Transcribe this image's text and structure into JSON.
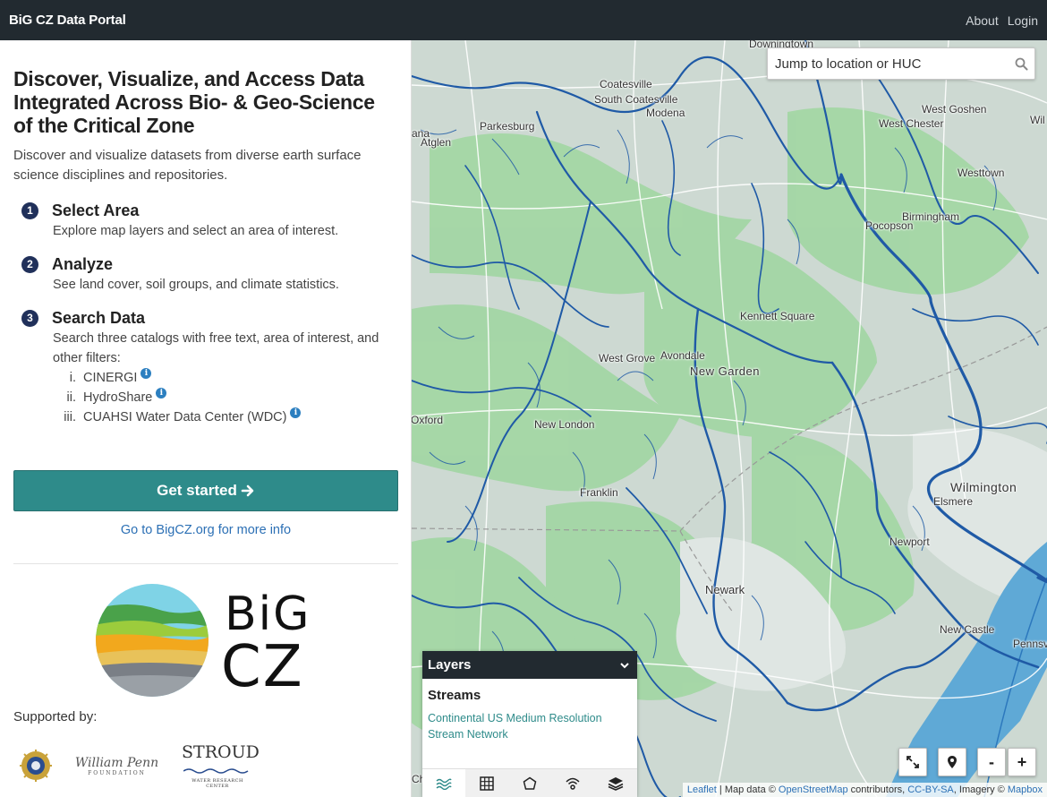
{
  "navbar": {
    "brand": "BiG CZ Data Portal",
    "links": [
      "About",
      "Login"
    ]
  },
  "sidebar": {
    "headline": "Discover, Visualize, and Access Data Integrated Across Bio- & Geo-Science of the Critical Zone",
    "lead": "Discover and visualize datasets from diverse earth surface science disciplines and repositories.",
    "steps": [
      {
        "num": "1",
        "title": "Select Area",
        "desc": "Explore map layers and select an area of interest."
      },
      {
        "num": "2",
        "title": "Analyze",
        "desc": "See land cover, soil groups, and climate statistics."
      },
      {
        "num": "3",
        "title": "Search Data",
        "desc": "Search three catalogs with free text, area of interest, and other filters:"
      }
    ],
    "catalogs": [
      {
        "numeral": "i.",
        "name": "CINERGI"
      },
      {
        "numeral": "ii.",
        "name": "HydroShare"
      },
      {
        "numeral": "iii.",
        "name": "CUAHSI Water Data Center (WDC)"
      }
    ],
    "cta": "Get started",
    "more_info": "Go to BigCZ.org for more info",
    "logo_text_line1": "BiG",
    "logo_text_line2": "CZ",
    "supported_by": "Supported by:",
    "sponsor_wpf_line1": "William Penn",
    "sponsor_wpf_line2": "FOUNDATION",
    "sponsor_stroud_line1": "STROUD",
    "sponsor_stroud_line2": "WATER RESEARCH CENTER"
  },
  "map": {
    "search_placeholder": "Jump to location or HUC",
    "places": [
      "Downingtown",
      "Coatesville",
      "South Coatesville",
      "Modena",
      "Parkesburg",
      "Atglen",
      "West Goshen",
      "West Chester",
      "Westtown",
      "Birmingham",
      "Pocopson",
      "Kennett Square",
      "West Grove",
      "Avondale",
      "New Garden",
      "New London",
      "Oxford",
      "Franklin",
      "Wilmington",
      "Elsmere",
      "Newport",
      "Newark",
      "New Castle",
      "Pennsville",
      "Charlestown",
      "ana",
      "Wil"
    ],
    "layers_panel": {
      "header": "Layers",
      "section": "Streams",
      "layer_name": "Continental US Medium Resolution Stream Network"
    },
    "attribution": {
      "leaflet": "Leaflet",
      "sep": " | Map data © ",
      "osm": "OpenStreetMap",
      "contrib": " contributors, ",
      "license": "CC-BY-SA",
      "imagery": ", Imagery © ",
      "mapbox": "Mapbox"
    },
    "controls": {
      "zoom_in": "+",
      "zoom_out": "-"
    }
  },
  "colors": {
    "navbar_bg": "#222a30",
    "cta_bg": "#2e8b8a",
    "step_badge": "#20305a",
    "link": "#2c70b5",
    "stream": "#1f5aa6",
    "water": "#5fa9d6"
  }
}
